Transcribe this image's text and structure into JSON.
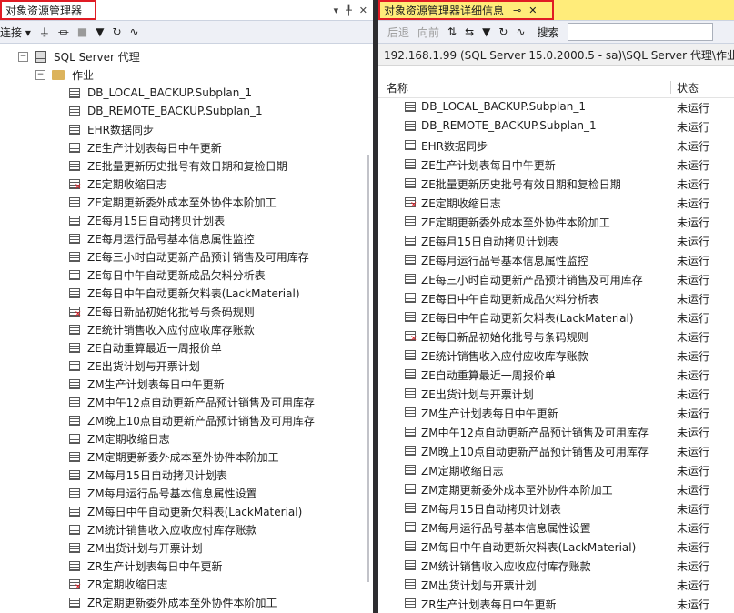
{
  "left": {
    "title": "对象资源管理器",
    "title_icons": [
      "dropdown-icon",
      "pin-icon",
      "close-icon"
    ],
    "toolbar": {
      "connect_label": "连接"
    },
    "server_label": "SQL Server 代理",
    "jobs_label": "作业",
    "jobs": [
      {
        "name": "DB_LOCAL_BACKUP.Subplan_1",
        "failed": false
      },
      {
        "name": "DB_REMOTE_BACKUP.Subplan_1",
        "failed": false
      },
      {
        "name": "EHR数据同步",
        "failed": false
      },
      {
        "name": "ZE生产计划表每日中午更新",
        "failed": false
      },
      {
        "name": "ZE批量更新历史批号有效日期和复检日期",
        "failed": false
      },
      {
        "name": "ZE定期收缩日志",
        "failed": true
      },
      {
        "name": "ZE定期更新委外成本至外协件本阶加工",
        "failed": false
      },
      {
        "name": "ZE每月15日自动拷贝计划表",
        "failed": false
      },
      {
        "name": "ZE每月运行品号基本信息属性监控",
        "failed": false
      },
      {
        "name": "ZE每三小时自动更新产品预计销售及可用库存",
        "failed": false
      },
      {
        "name": "ZE每日中午自动更新成品欠料分析表",
        "failed": false
      },
      {
        "name": "ZE每日中午自动更新欠料表(LackMaterial)",
        "failed": false
      },
      {
        "name": "ZE每日新品初始化批号与条码规则",
        "failed": true
      },
      {
        "name": "ZE统计销售收入应付应收库存账款",
        "failed": false
      },
      {
        "name": "ZE自动重算最近一周报价单",
        "failed": false
      },
      {
        "name": "ZE出货计划与开票计划",
        "failed": false
      },
      {
        "name": "ZM生产计划表每日中午更新",
        "failed": false
      },
      {
        "name": "ZM中午12点自动更新产品预计销售及可用库存",
        "failed": false
      },
      {
        "name": "ZM晚上10点自动更新产品预计销售及可用库存",
        "failed": false
      },
      {
        "name": "ZM定期收缩日志",
        "failed": false
      },
      {
        "name": "ZM定期更新委外成本至外协件本阶加工",
        "failed": false
      },
      {
        "name": "ZM每月15日自动拷贝计划表",
        "failed": false
      },
      {
        "name": "ZM每月运行品号基本信息属性设置",
        "failed": false
      },
      {
        "name": "ZM每日中午自动更新欠料表(LackMaterial)",
        "failed": false
      },
      {
        "name": "ZM统计销售收入应收应付库存账款",
        "failed": false
      },
      {
        "name": "ZM出货计划与开票计划",
        "failed": false
      },
      {
        "name": "ZR生产计划表每日中午更新",
        "failed": false
      },
      {
        "name": "ZR定期收缩日志",
        "failed": true
      },
      {
        "name": "ZR定期更新委外成本至外协件本阶加工",
        "failed": false
      }
    ]
  },
  "right": {
    "title": "对象资源管理器详细信息",
    "toolbar": {
      "back_label": "后退",
      "forward_label": "向前",
      "search_label": "搜索"
    },
    "path": "192.168.1.99 (SQL Server 15.0.2000.5 - sa)\\SQL Server 代理\\作业",
    "columns": {
      "name": "名称",
      "status": "状态"
    },
    "rows": [
      {
        "name": "DB_LOCAL_BACKUP.Subplan_1",
        "status": "未运行",
        "failed": false
      },
      {
        "name": "DB_REMOTE_BACKUP.Subplan_1",
        "status": "未运行",
        "failed": false
      },
      {
        "name": "EHR数据同步",
        "status": "未运行",
        "failed": false
      },
      {
        "name": "ZE生产计划表每日中午更新",
        "status": "未运行",
        "failed": false
      },
      {
        "name": "ZE批量更新历史批号有效日期和复检日期",
        "status": "未运行",
        "failed": false
      },
      {
        "name": "ZE定期收缩日志",
        "status": "未运行",
        "failed": true
      },
      {
        "name": "ZE定期更新委外成本至外协件本阶加工",
        "status": "未运行",
        "failed": false
      },
      {
        "name": "ZE每月15日自动拷贝计划表",
        "status": "未运行",
        "failed": false
      },
      {
        "name": "ZE每月运行品号基本信息属性监控",
        "status": "未运行",
        "failed": false
      },
      {
        "name": "ZE每三小时自动更新产品预计销售及可用库存",
        "status": "未运行",
        "failed": false
      },
      {
        "name": "ZE每日中午自动更新成品欠料分析表",
        "status": "未运行",
        "failed": false
      },
      {
        "name": "ZE每日中午自动更新欠料表(LackMaterial)",
        "status": "未运行",
        "failed": false
      },
      {
        "name": "ZE每日新品初始化批号与条码规则",
        "status": "未运行",
        "failed": true
      },
      {
        "name": "ZE统计销售收入应付应收库存账款",
        "status": "未运行",
        "failed": false
      },
      {
        "name": "ZE自动重算最近一周报价单",
        "status": "未运行",
        "failed": false
      },
      {
        "name": "ZE出货计划与开票计划",
        "status": "未运行",
        "failed": false
      },
      {
        "name": "ZM生产计划表每日中午更新",
        "status": "未运行",
        "failed": false
      },
      {
        "name": "ZM中午12点自动更新产品预计销售及可用库存",
        "status": "未运行",
        "failed": false
      },
      {
        "name": "ZM晚上10点自动更新产品预计销售及可用库存",
        "status": "未运行",
        "failed": false
      },
      {
        "name": "ZM定期收缩日志",
        "status": "未运行",
        "failed": false
      },
      {
        "name": "ZM定期更新委外成本至外协件本阶加工",
        "status": "未运行",
        "failed": false
      },
      {
        "name": "ZM每月15日自动拷贝计划表",
        "status": "未运行",
        "failed": false
      },
      {
        "name": "ZM每月运行品号基本信息属性设置",
        "status": "未运行",
        "failed": false
      },
      {
        "name": "ZM每日中午自动更新欠料表(LackMaterial)",
        "status": "未运行",
        "failed": false
      },
      {
        "name": "ZM统计销售收入应收应付库存账款",
        "status": "未运行",
        "failed": false
      },
      {
        "name": "ZM出货计划与开票计划",
        "status": "未运行",
        "failed": false
      },
      {
        "name": "ZR生产计划表每日中午更新",
        "status": "未运行",
        "failed": false
      }
    ]
  },
  "colors": {
    "active_title": "#ffec7a",
    "highlight_border": "#e01b24",
    "splitter": "#2d2d30"
  }
}
